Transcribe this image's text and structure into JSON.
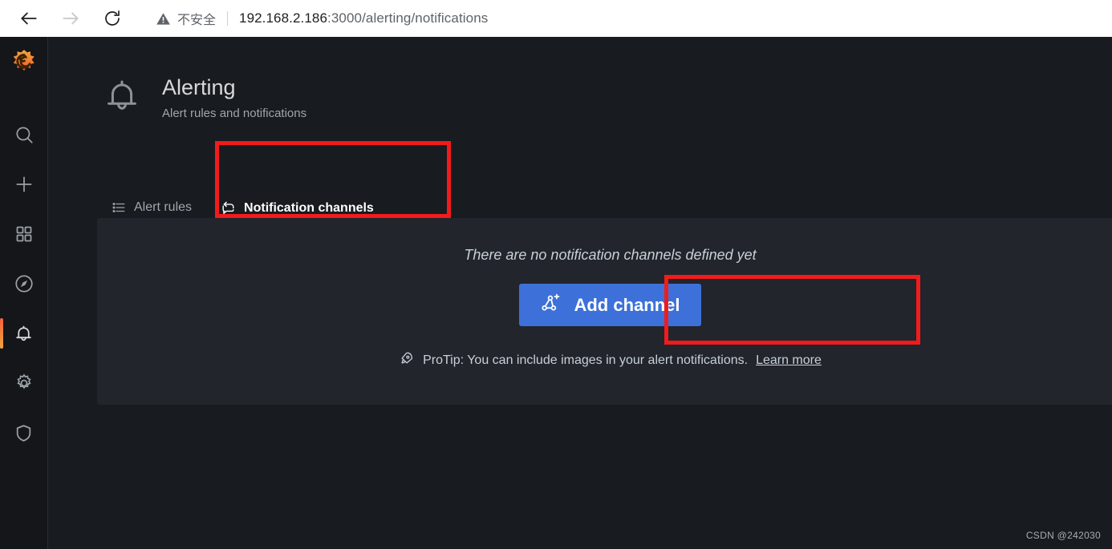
{
  "browser": {
    "back_icon": "arrow-left-icon",
    "forward_icon": "arrow-right-icon",
    "reload_icon": "reload-icon",
    "security_icon": "warning-triangle-icon",
    "security_label": "不安全",
    "url_host": "192.168.2.186",
    "url_path": ":3000/alerting/notifications",
    "url_full": "192.168.2.186:3000/alerting/notifications"
  },
  "sidebar": {
    "brand": "grafana-logo",
    "items": [
      {
        "name": "search",
        "icon": "search-icon",
        "active": false
      },
      {
        "name": "create",
        "icon": "plus-icon",
        "active": false
      },
      {
        "name": "dashboards",
        "icon": "apps-grid-icon",
        "active": false
      },
      {
        "name": "explore",
        "icon": "compass-icon",
        "active": false
      },
      {
        "name": "alerting",
        "icon": "bell-icon",
        "active": true
      },
      {
        "name": "configuration",
        "icon": "gear-icon",
        "active": false
      },
      {
        "name": "server-admin",
        "icon": "shield-icon",
        "active": false
      }
    ]
  },
  "header": {
    "icon": "bell-icon",
    "title": "Alerting",
    "subtitle": "Alert rules and notifications"
  },
  "tabs": [
    {
      "label": "Alert rules",
      "icon": "list-ul-icon",
      "active": false
    },
    {
      "label": "Notification channels",
      "icon": "comment-share-icon",
      "active": true
    }
  ],
  "empty_state": {
    "message": "There are no notification channels defined yet",
    "button_label": "Add channel",
    "button_icon": "channel-add-icon",
    "button_color": "#3d71d9",
    "protip_icon": "rocket-icon",
    "protip_text": "ProTip: You can include images in your alert notifications.",
    "protip_link": "Learn more"
  },
  "annotations": {
    "color": "#f21b1b",
    "boxes": [
      {
        "target": "notification-channels-tab"
      },
      {
        "target": "add-channel-button"
      }
    ]
  },
  "watermark": "CSDN @242030"
}
